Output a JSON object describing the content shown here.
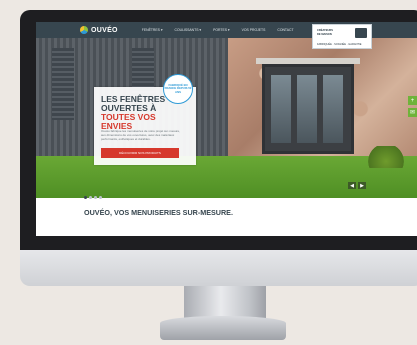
{
  "site": {
    "logo_text": "OUVÉO",
    "menu": [
      "FENÊTRES ▾",
      "COULISSANTS ▾",
      "PORTES ▾",
      "VOS PROJETS",
      "CONTACT"
    ],
    "label_box": {
      "line1": "CRÉATEURS",
      "line2": "DE MAISON",
      "line3": "FABRIQUÉE · SOIGNÉE · GARANTIE"
    }
  },
  "hero": {
    "title_line1": "LES FENÊTRES",
    "title_line2": "OUVERTES À",
    "title_accent": "TOUTES VOS ENVIES",
    "body": "Ouvéo fabrique les menuiseries de votre projet sur-mesure, aux dimensions de vos ouvertures, avec des matériaux performants, esthétiques et durables.",
    "cta": "DÉCOUVRIR NOS PRODUITS",
    "badge": "FABRIQUÉ EN FRANCE DEPUIS 50 ANS",
    "arrow_prev": "◀",
    "arrow_next": "▶",
    "side_tab_1": "+",
    "side_tab_2": "✉"
  },
  "carousel": {
    "slides": 4,
    "active": 1
  },
  "tagline": "OUVÉO, VOS MENUISERIES SUR-MESURE."
}
